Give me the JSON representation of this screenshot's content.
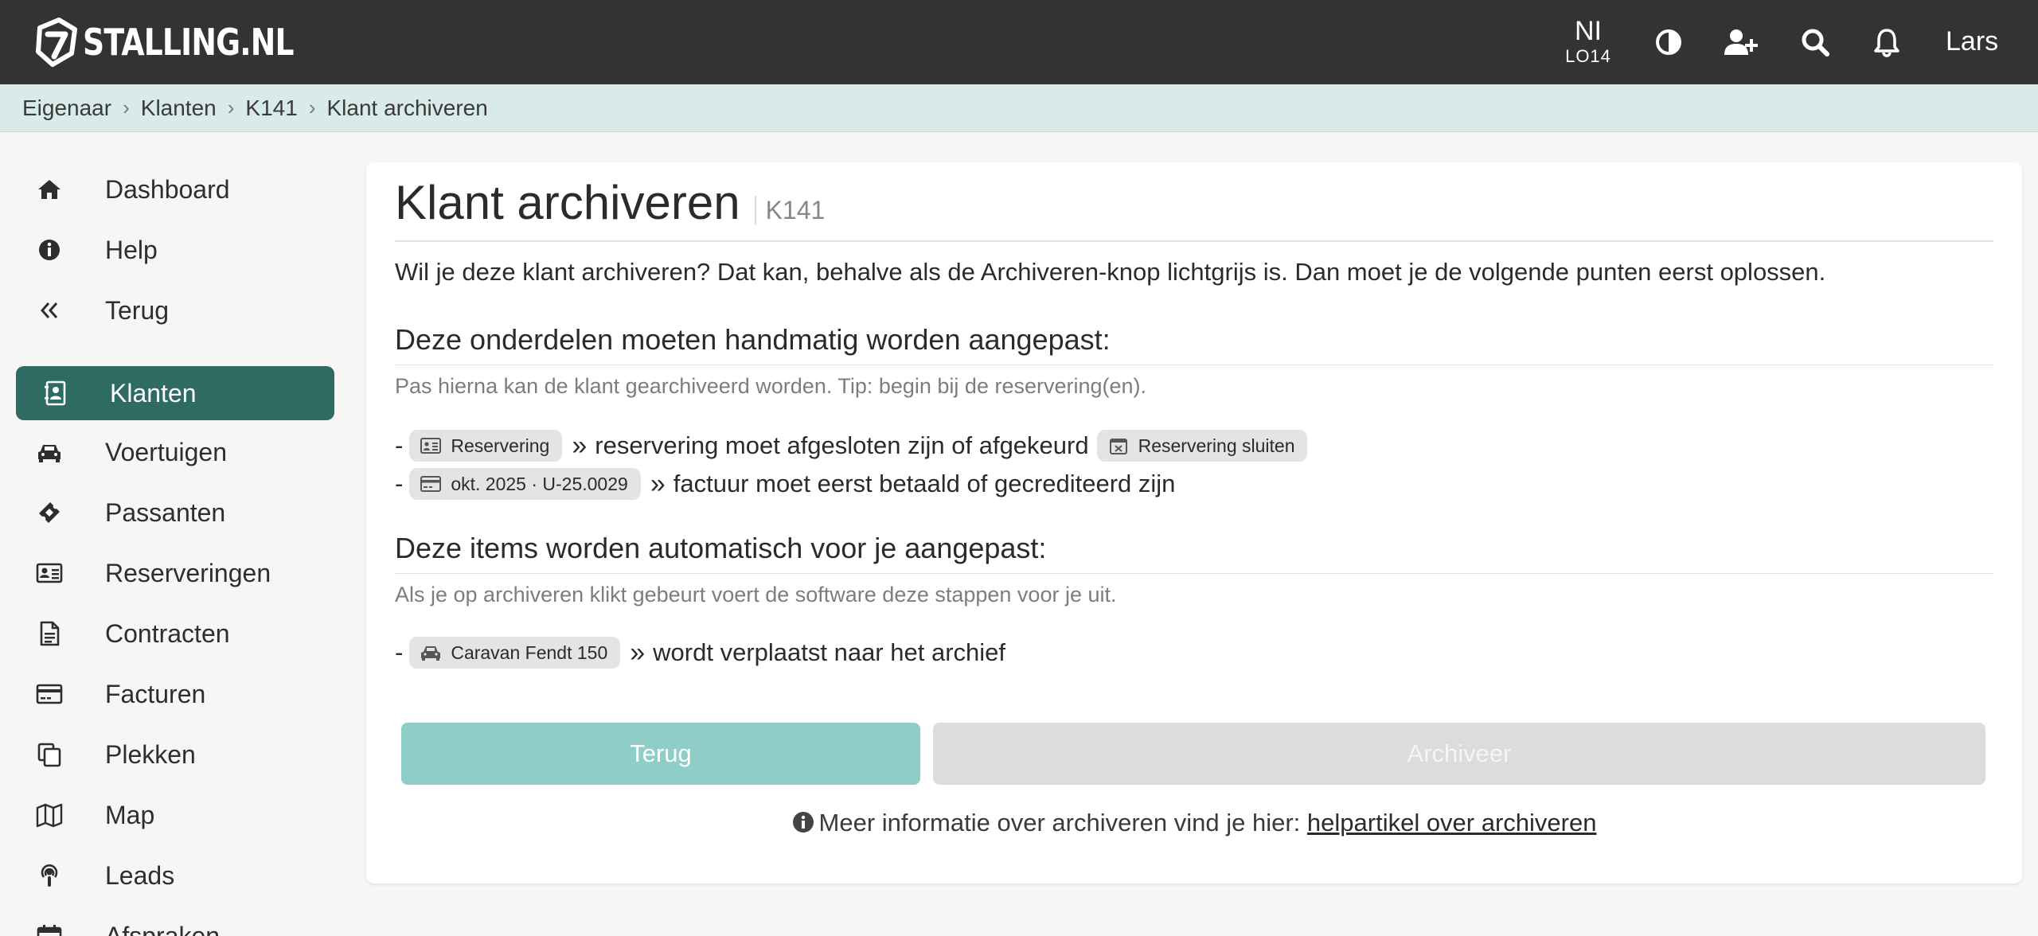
{
  "header": {
    "logo_text": "STALLING.NL",
    "location_code": "NI",
    "location_sub": "LO14",
    "user_name": "Lars"
  },
  "breadcrumb": [
    "Eigenaar",
    "Klanten",
    "K141",
    "Klant archiveren"
  ],
  "sidebar": {
    "items": [
      {
        "label": "Dashboard",
        "icon": "home-icon"
      },
      {
        "label": "Help",
        "icon": "info-icon"
      },
      {
        "label": "Terug",
        "icon": "double-chevron-left-icon"
      },
      {
        "label": "Klanten",
        "icon": "contact-book-icon",
        "active": true
      },
      {
        "label": "Voertuigen",
        "icon": "car-icon"
      },
      {
        "label": "Passanten",
        "icon": "ticket-icon"
      },
      {
        "label": "Reserveringen",
        "icon": "id-card-icon"
      },
      {
        "label": "Contracten",
        "icon": "document-icon"
      },
      {
        "label": "Facturen",
        "icon": "credit-card-icon"
      },
      {
        "label": "Plekken",
        "icon": "copy-icon"
      },
      {
        "label": "Map",
        "icon": "map-icon"
      },
      {
        "label": "Leads",
        "icon": "podcast-icon"
      },
      {
        "label": "Afspraken",
        "icon": "calendar-icon"
      }
    ]
  },
  "main": {
    "title": "Klant archiveren",
    "title_sub": "K141",
    "intro": "Wil je deze klant archiveren? Dat kan, behalve als de Archiveren-knop lichtgrijs is. Dan moet je de volgende punten eerst oplossen.",
    "manual": {
      "heading": "Deze onderdelen moeten handmatig worden aangepast:",
      "hint": "Pas hierna kan de klant gearchiveerd worden. Tip: begin bij de reservering(en).",
      "rows": [
        {
          "pill": "Reservering",
          "text": "reservering moet afgesloten zijn of afgekeurd",
          "action": "Reservering sluiten"
        },
        {
          "pill": "okt. 2025 · U-25.0029",
          "text": "factuur moet eerst betaald of gecrediteerd zijn"
        }
      ]
    },
    "automatic": {
      "heading": "Deze items worden automatisch voor je aangepast:",
      "hint": "Als je op archiveren klikt gebeurt voert de software deze stappen voor je uit.",
      "rows": [
        {
          "pill": "Caravan Fendt 150",
          "text": "wordt verplaatst naar het archief"
        }
      ]
    },
    "dash": "-",
    "raquo": "»",
    "buttons": {
      "back": "Terug",
      "archive": "Archiveer"
    },
    "info_text": "Meer informatie over archiveren vind je hier:",
    "info_link": "helpartikel over archiveren"
  },
  "colors": {
    "header_bg": "#333333",
    "breadcrumb_bg": "#d8ebe9",
    "active_nav": "#2e6b62",
    "back_button": "#8fcdc8",
    "archive_disabled": "#dcdcdc"
  }
}
